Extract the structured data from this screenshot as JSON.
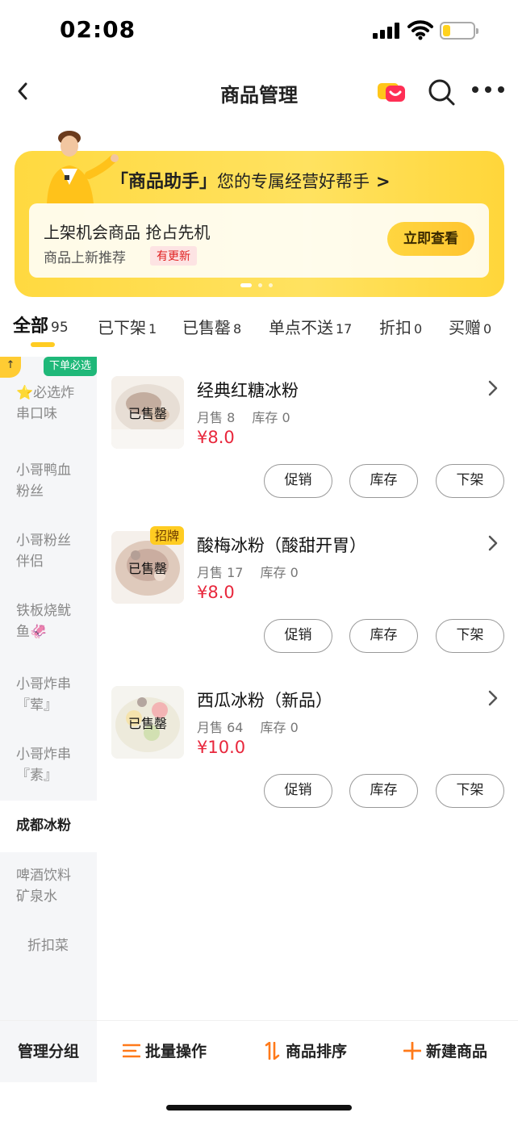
{
  "status_bar": {
    "time": "02:08",
    "battery_fraction": 0.25,
    "battery_color": "#ffd21f"
  },
  "nav": {
    "title": "商品管理"
  },
  "banner": {
    "title_bracket": "「商品助手」",
    "title_rest": "您的专属经营好帮手",
    "chevron": ">",
    "card_title": "上架机会商品 抢占先机",
    "card_subtitle": "商品上新推荐",
    "update_badge": "有更新",
    "view_button": "立即查看"
  },
  "tabs": [
    {
      "label": "全部",
      "count": "95",
      "active": true
    },
    {
      "label": "已下架",
      "count": "1"
    },
    {
      "label": "已售罄",
      "count": "8"
    },
    {
      "label": "单点不送",
      "count": "17"
    },
    {
      "label": "折扣",
      "count": "0"
    },
    {
      "label": "买赠",
      "count": "0"
    }
  ],
  "sidebar": {
    "top_badge": "↑",
    "must_badge": "下单必选",
    "items": [
      {
        "line1": "⭐必选炸",
        "line2": "串口味"
      },
      {
        "line1": "小哥鸭血",
        "line2": "粉丝"
      },
      {
        "line1": "小哥粉丝",
        "line2": "伴侣"
      },
      {
        "line1": "铁板烧鱿",
        "line2": "鱼🦑"
      },
      {
        "line1": "小哥炸串",
        "line2": "『荤』"
      },
      {
        "line1": "小哥炸串",
        "line2": "『素』"
      },
      {
        "line1": "成都冰粉",
        "line2": "",
        "active": true
      },
      {
        "line1": "啤酒饮料",
        "line2": "矿泉水"
      },
      {
        "line1": "折扣菜",
        "line2": ""
      }
    ]
  },
  "products": [
    {
      "name": "经典红糖冰粉",
      "sales": "月售 8",
      "stock": "库存 0",
      "price": "¥8.0",
      "overlay": "已售罄",
      "tag": "",
      "buttons": [
        "促销",
        "库存",
        "下架"
      ]
    },
    {
      "name": "酸梅冰粉（酸甜开胃）",
      "sales": "月售 17",
      "stock": "库存 0",
      "price": "¥8.0",
      "overlay": "已售罄",
      "tag": "招牌",
      "buttons": [
        "促销",
        "库存",
        "下架"
      ]
    },
    {
      "name": "西瓜冰粉（新品）",
      "sales": "月售 64",
      "stock": "库存 0",
      "price": "¥10.0",
      "overlay": "已售罄",
      "tag": "",
      "buttons": [
        "促销",
        "库存",
        "下架"
      ]
    }
  ],
  "bottom_bar": {
    "manage_group": "管理分组",
    "batch": "批量操作",
    "sort": "商品排序",
    "create": "新建商品"
  },
  "colors": {
    "accent_yellow": "#ffcc22",
    "price_red": "#e8273c",
    "action_orange": "#ff7a1a",
    "must_green": "#1fb879"
  },
  "icons": [
    "back-icon",
    "message-icon",
    "search-icon",
    "more-icon",
    "chevron-right-icon",
    "list-icon",
    "sort-icon",
    "plus-icon"
  ]
}
